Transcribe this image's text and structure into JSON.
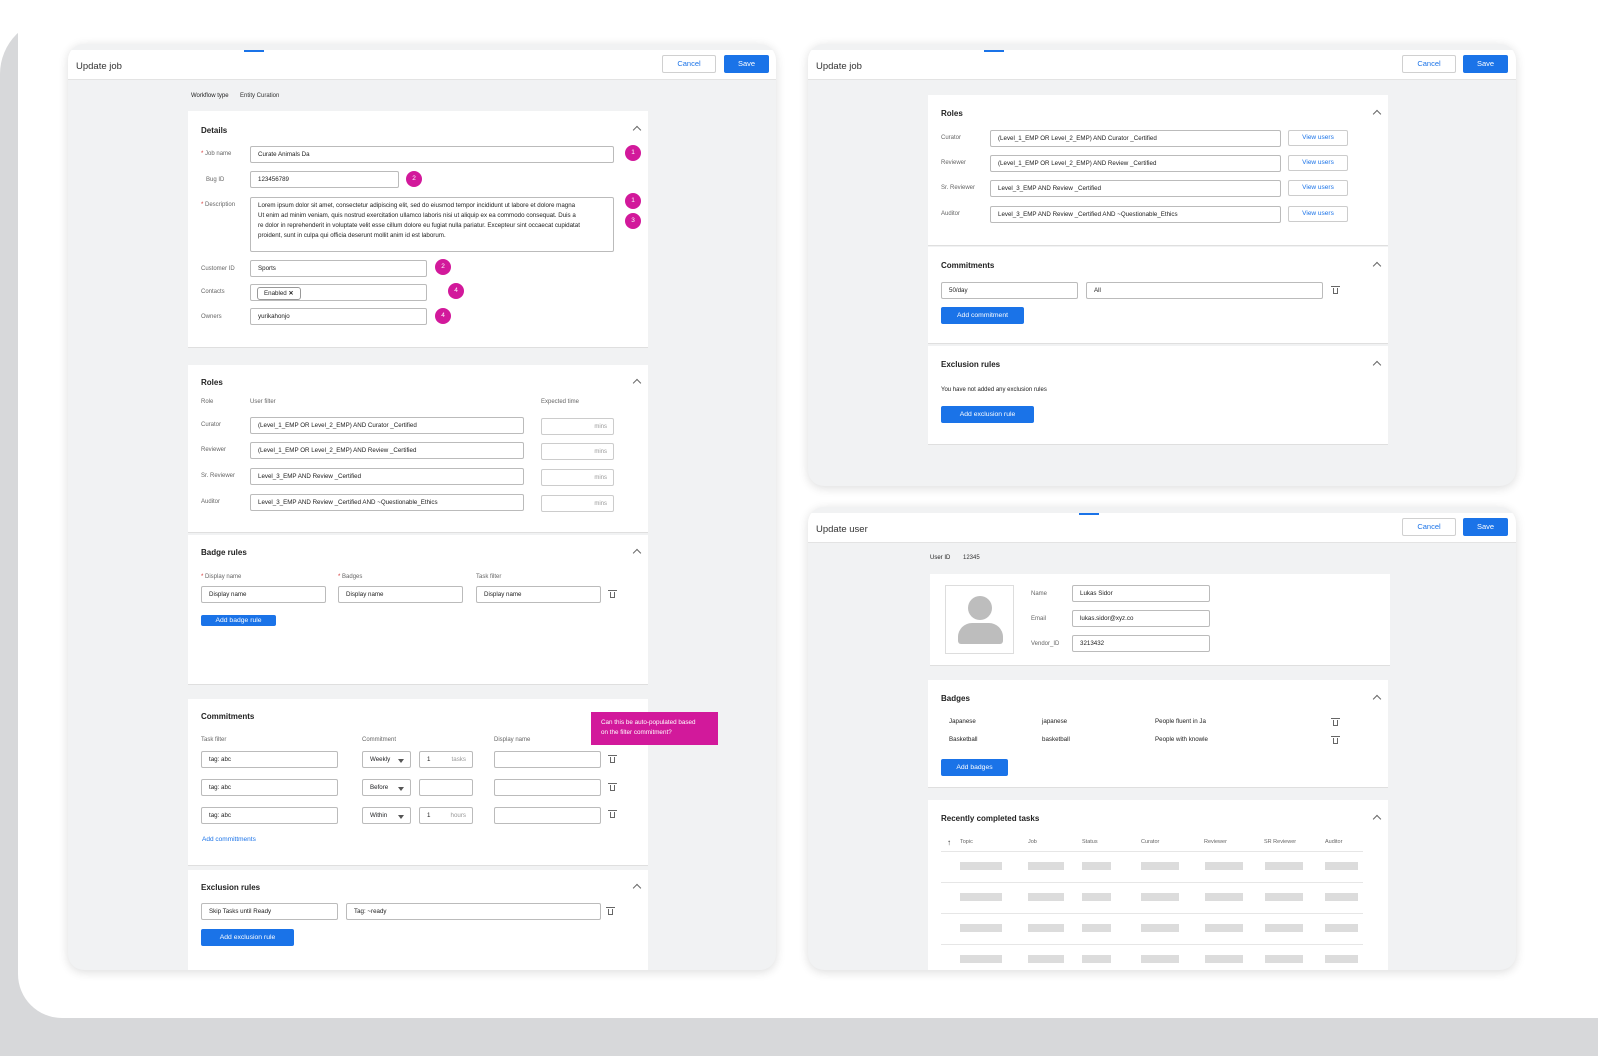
{
  "update_job_form": {
    "title": "Update job",
    "cancel": "Cancel",
    "save": "Save",
    "workflow_label": "Workflow type",
    "workflow_value": "Entity Curation",
    "details": {
      "title": "Details",
      "job_name_label": "Job name",
      "job_name": "Curate Animals Da",
      "bug_id_label": "Bug ID",
      "bug_id": "123456789",
      "description_label": "Description",
      "description": [
        "Lorem ipsum dolor sit amet, consectetur adipiscing elit, sed do eiusmod tempor incididunt ut labore et dolore magna",
        "Ut enim ad minim veniam, quis nostrud exercitation ullamco laboris nisi ut aliquip ex ea commodo consequat. Duis a",
        "re dolor in reprehenderit in voluptate velit esse cillum dolore eu fugiat nulla pariatur. Excepteur sint occaecat cupidatat",
        "proident, sunt in culpa qui officia deserunt mollit anim id est laborum."
      ],
      "customer_id_label": "Customer ID",
      "customer_id": "Sports",
      "contacts_label": "Contacts",
      "contacts_chip": "Enabled",
      "owners_label": "Owners",
      "owners": "yurikahonjo",
      "badges": [
        "1",
        "2",
        "1",
        "3",
        "2",
        "4",
        "4"
      ]
    },
    "roles": {
      "title": "Roles",
      "col_role": "Role",
      "col_filter": "User filter",
      "col_time": "Expected time",
      "mins": "mins",
      "rows": [
        {
          "role": "Curator",
          "filter": "(Level_1_EMP OR Level_2_EMP) AND Curator _Certified"
        },
        {
          "role": "Reviewer",
          "filter": "(Level_1_EMP OR Level_2_EMP) AND Review _Certified"
        },
        {
          "role": "Sr. Reviewer",
          "filter": "Level_3_EMP AND Review _Certified"
        },
        {
          "role": "Auditor",
          "filter": "Level_3_EMP AND Review _Certified AND ~Questionable_Ethics"
        }
      ]
    },
    "badge_rules": {
      "title": "Badge rules",
      "display_label": "Display name",
      "badges_label": "Badges",
      "task_filter_label": "Task filter",
      "display_value": "Display name",
      "badges_value": "Display name",
      "task_value": "Display name",
      "add": "Add badge rule"
    },
    "commitments": {
      "title": "Commitments",
      "col_task": "Task filter",
      "col_commit": "Commitment",
      "col_display": "Display name",
      "tooltip": [
        "Can this be auto-populated based",
        "on the filter commitment?"
      ],
      "rows": [
        {
          "filter": "tag: abc",
          "period": "Weekly",
          "num": "1",
          "unit": "tasks"
        },
        {
          "filter": "tag: abc",
          "period": "Before",
          "num": "",
          "unit": ""
        },
        {
          "filter": "tag: abc",
          "period": "Within",
          "num": "1",
          "unit": "hours"
        }
      ],
      "add": "Add committments"
    },
    "exclusion": {
      "title": "Exclusion rules",
      "rule": "Skip Tasks until Ready",
      "tag": "Tag: ~ready",
      "add": "Add exclusion rule"
    }
  },
  "update_job_small": {
    "title": "Update job",
    "cancel": "Cancel",
    "save": "Save",
    "roles": {
      "title": "Roles",
      "view": "View users",
      "rows": [
        {
          "role": "Curator",
          "filter": "(Level_1_EMP OR Level_2_EMP) AND Curator _Certified"
        },
        {
          "role": "Reviewer",
          "filter": "(Level_1_EMP OR Level_2_EMP) AND Review _Certified"
        },
        {
          "role": "Sr. Reviewer",
          "filter": "Level_3_EMP AND Review _Certified"
        },
        {
          "role": "Auditor",
          "filter": "Level_3_EMP AND Review _Certified AND ~Questionable_Ethics"
        }
      ]
    },
    "commitments": {
      "title": "Commitments",
      "value": "50/day",
      "filter": "All",
      "add": "Add commitment"
    },
    "exclusion": {
      "title": "Exclusion rules",
      "empty": "You have not added any exclusion rules",
      "add": "Add exclusion rule"
    }
  },
  "update_user": {
    "title": "Update user",
    "cancel": "Cancel",
    "save": "Save",
    "user_id_label": "User ID",
    "user_id": "12345",
    "name_label": "Name",
    "name": "Lukas Sidor",
    "email_label": "Email",
    "email": "lukas.sidor@xyz.co",
    "vendor_label": "Vendor_ID",
    "vendor": "3213432",
    "badges": {
      "title": "Badges",
      "rows": [
        {
          "name": "Japanese",
          "key": "japanese",
          "desc": "People fluent in Ja"
        },
        {
          "name": "Basketball",
          "key": "basketball",
          "desc": "People with knowle"
        }
      ],
      "add": "Add badges"
    },
    "tasks": {
      "title": "Recently completed tasks",
      "columns": [
        "Topic",
        "Job",
        "Status",
        "Curator",
        "Reviewer",
        "SR Reviewer",
        "Auditor"
      ]
    }
  }
}
